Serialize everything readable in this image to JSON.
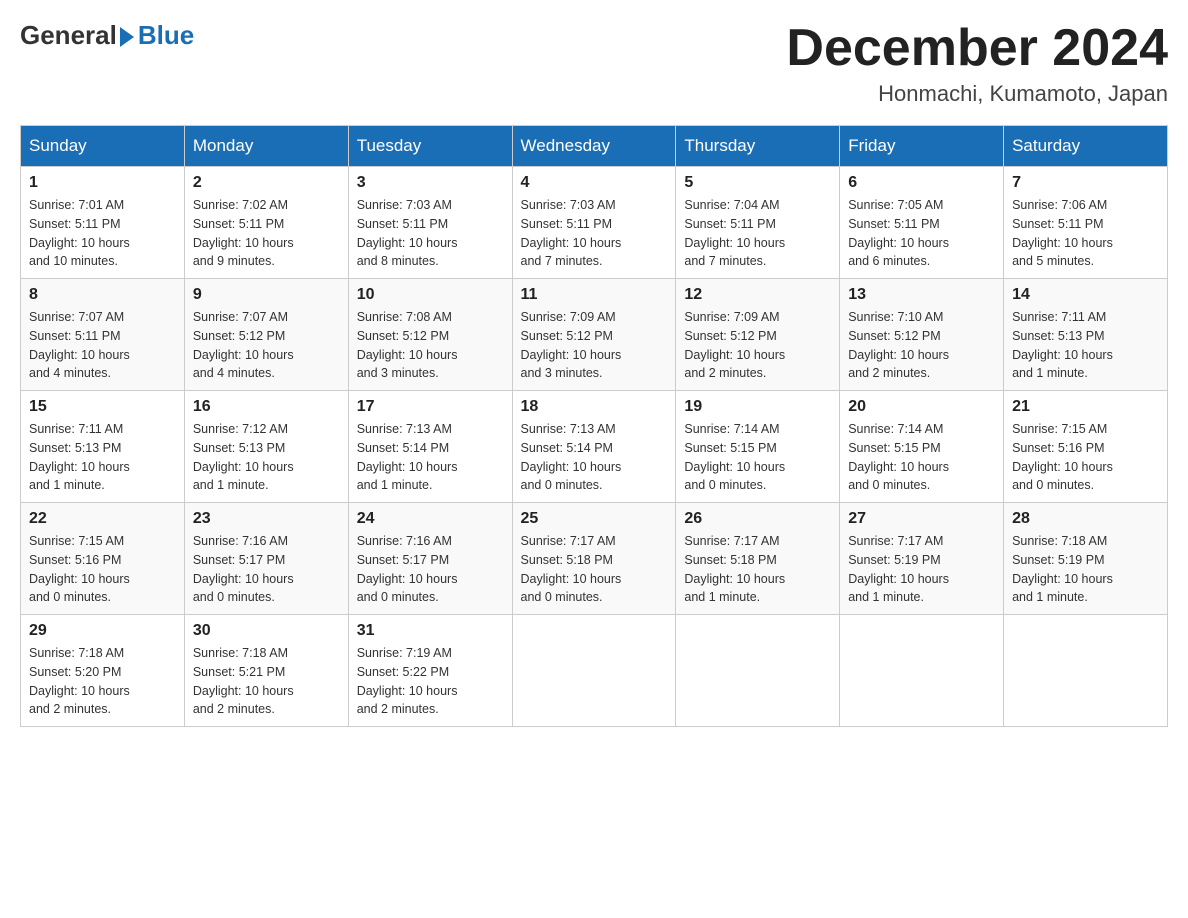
{
  "header": {
    "logo_general": "General",
    "logo_blue": "Blue",
    "month_title": "December 2024",
    "location": "Honmachi, Kumamoto, Japan"
  },
  "days_of_week": [
    "Sunday",
    "Monday",
    "Tuesday",
    "Wednesday",
    "Thursday",
    "Friday",
    "Saturday"
  ],
  "weeks": [
    [
      {
        "day": "1",
        "sunrise": "7:01 AM",
        "sunset": "5:11 PM",
        "daylight": "10 hours and 10 minutes."
      },
      {
        "day": "2",
        "sunrise": "7:02 AM",
        "sunset": "5:11 PM",
        "daylight": "10 hours and 9 minutes."
      },
      {
        "day": "3",
        "sunrise": "7:03 AM",
        "sunset": "5:11 PM",
        "daylight": "10 hours and 8 minutes."
      },
      {
        "day": "4",
        "sunrise": "7:03 AM",
        "sunset": "5:11 PM",
        "daylight": "10 hours and 7 minutes."
      },
      {
        "day": "5",
        "sunrise": "7:04 AM",
        "sunset": "5:11 PM",
        "daylight": "10 hours and 7 minutes."
      },
      {
        "day": "6",
        "sunrise": "7:05 AM",
        "sunset": "5:11 PM",
        "daylight": "10 hours and 6 minutes."
      },
      {
        "day": "7",
        "sunrise": "7:06 AM",
        "sunset": "5:11 PM",
        "daylight": "10 hours and 5 minutes."
      }
    ],
    [
      {
        "day": "8",
        "sunrise": "7:07 AM",
        "sunset": "5:11 PM",
        "daylight": "10 hours and 4 minutes."
      },
      {
        "day": "9",
        "sunrise": "7:07 AM",
        "sunset": "5:12 PM",
        "daylight": "10 hours and 4 minutes."
      },
      {
        "day": "10",
        "sunrise": "7:08 AM",
        "sunset": "5:12 PM",
        "daylight": "10 hours and 3 minutes."
      },
      {
        "day": "11",
        "sunrise": "7:09 AM",
        "sunset": "5:12 PM",
        "daylight": "10 hours and 3 minutes."
      },
      {
        "day": "12",
        "sunrise": "7:09 AM",
        "sunset": "5:12 PM",
        "daylight": "10 hours and 2 minutes."
      },
      {
        "day": "13",
        "sunrise": "7:10 AM",
        "sunset": "5:12 PM",
        "daylight": "10 hours and 2 minutes."
      },
      {
        "day": "14",
        "sunrise": "7:11 AM",
        "sunset": "5:13 PM",
        "daylight": "10 hours and 1 minute."
      }
    ],
    [
      {
        "day": "15",
        "sunrise": "7:11 AM",
        "sunset": "5:13 PM",
        "daylight": "10 hours and 1 minute."
      },
      {
        "day": "16",
        "sunrise": "7:12 AM",
        "sunset": "5:13 PM",
        "daylight": "10 hours and 1 minute."
      },
      {
        "day": "17",
        "sunrise": "7:13 AM",
        "sunset": "5:14 PM",
        "daylight": "10 hours and 1 minute."
      },
      {
        "day": "18",
        "sunrise": "7:13 AM",
        "sunset": "5:14 PM",
        "daylight": "10 hours and 0 minutes."
      },
      {
        "day": "19",
        "sunrise": "7:14 AM",
        "sunset": "5:15 PM",
        "daylight": "10 hours and 0 minutes."
      },
      {
        "day": "20",
        "sunrise": "7:14 AM",
        "sunset": "5:15 PM",
        "daylight": "10 hours and 0 minutes."
      },
      {
        "day": "21",
        "sunrise": "7:15 AM",
        "sunset": "5:16 PM",
        "daylight": "10 hours and 0 minutes."
      }
    ],
    [
      {
        "day": "22",
        "sunrise": "7:15 AM",
        "sunset": "5:16 PM",
        "daylight": "10 hours and 0 minutes."
      },
      {
        "day": "23",
        "sunrise": "7:16 AM",
        "sunset": "5:17 PM",
        "daylight": "10 hours and 0 minutes."
      },
      {
        "day": "24",
        "sunrise": "7:16 AM",
        "sunset": "5:17 PM",
        "daylight": "10 hours and 0 minutes."
      },
      {
        "day": "25",
        "sunrise": "7:17 AM",
        "sunset": "5:18 PM",
        "daylight": "10 hours and 0 minutes."
      },
      {
        "day": "26",
        "sunrise": "7:17 AM",
        "sunset": "5:18 PM",
        "daylight": "10 hours and 1 minute."
      },
      {
        "day": "27",
        "sunrise": "7:17 AM",
        "sunset": "5:19 PM",
        "daylight": "10 hours and 1 minute."
      },
      {
        "day": "28",
        "sunrise": "7:18 AM",
        "sunset": "5:19 PM",
        "daylight": "10 hours and 1 minute."
      }
    ],
    [
      {
        "day": "29",
        "sunrise": "7:18 AM",
        "sunset": "5:20 PM",
        "daylight": "10 hours and 2 minutes."
      },
      {
        "day": "30",
        "sunrise": "7:18 AM",
        "sunset": "5:21 PM",
        "daylight": "10 hours and 2 minutes."
      },
      {
        "day": "31",
        "sunrise": "7:19 AM",
        "sunset": "5:22 PM",
        "daylight": "10 hours and 2 minutes."
      },
      null,
      null,
      null,
      null
    ]
  ],
  "labels": {
    "sunrise": "Sunrise:",
    "sunset": "Sunset:",
    "daylight": "Daylight:"
  }
}
